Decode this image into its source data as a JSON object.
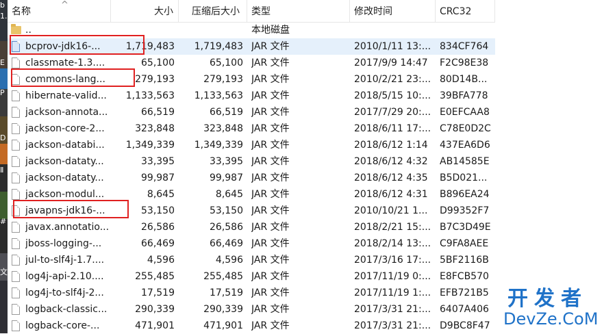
{
  "left_strip": {
    "glyphs": [
      "b",
      "1.",
      "E",
      "P",
      "D",
      "Ⅱ",
      "#",
      "文"
    ]
  },
  "header": {
    "columns": {
      "name": "名称",
      "size": "大小",
      "packed_size": "压缩后大小",
      "type": "类型",
      "modified": "修改时间",
      "crc": "CRC32"
    },
    "sort_indicator": "^"
  },
  "rows": [
    {
      "icon": "folder",
      "name": "..",
      "size": "",
      "packed": "",
      "type": "本地磁盘",
      "modified": "",
      "crc": ""
    },
    {
      "icon": "file",
      "name": "bcprov-jdk16-...",
      "size": "1,719,483",
      "packed": "1,719,483",
      "type": "JAR 文件",
      "modified": "2010/1/11 13:...",
      "crc": "834CF764"
    },
    {
      "icon": "file",
      "name": "classmate-1.3....",
      "size": "65,100",
      "packed": "65,100",
      "type": "JAR 文件",
      "modified": "2017/9/9 14:47",
      "crc": "F2C98E38"
    },
    {
      "icon": "file",
      "name": "commons-lang...",
      "size": "279,193",
      "packed": "279,193",
      "type": "JAR 文件",
      "modified": "2010/2/21 23:...",
      "crc": "80D14B..."
    },
    {
      "icon": "file",
      "name": "hibernate-valid...",
      "size": "1,133,563",
      "packed": "1,133,563",
      "type": "JAR 文件",
      "modified": "2018/5/15 10:...",
      "crc": "39BFA778"
    },
    {
      "icon": "file",
      "name": "jackson-annota...",
      "size": "66,519",
      "packed": "66,519",
      "type": "JAR 文件",
      "modified": "2017/7/29 20:...",
      "crc": "E0EFCAA8"
    },
    {
      "icon": "file",
      "name": "jackson-core-2...",
      "size": "323,848",
      "packed": "323,848",
      "type": "JAR 文件",
      "modified": "2018/6/11 17:...",
      "crc": "C78E0D2C"
    },
    {
      "icon": "file",
      "name": "jackson-databi...",
      "size": "1,349,339",
      "packed": "1,349,339",
      "type": "JAR 文件",
      "modified": "2018/6/12 1:14",
      "crc": "437EA6D6"
    },
    {
      "icon": "file",
      "name": "jackson-dataty...",
      "size": "33,395",
      "packed": "33,395",
      "type": "JAR 文件",
      "modified": "2018/6/12 4:32",
      "crc": "AB14585E"
    },
    {
      "icon": "file",
      "name": "jackson-dataty...",
      "size": "99,987",
      "packed": "99,987",
      "type": "JAR 文件",
      "modified": "2018/6/12 4:35",
      "crc": "B5D021..."
    },
    {
      "icon": "file",
      "name": "jackson-modul...",
      "size": "8,645",
      "packed": "8,645",
      "type": "JAR 文件",
      "modified": "2018/6/12 4:31",
      "crc": "B896EA24"
    },
    {
      "icon": "file",
      "name": "javapns-jdk16-...",
      "size": "53,150",
      "packed": "53,150",
      "type": "JAR 文件",
      "modified": "2010/10/21 1...",
      "crc": "D99352F7"
    },
    {
      "icon": "file",
      "name": "javax.annotatio...",
      "size": "26,586",
      "packed": "26,586",
      "type": "JAR 文件",
      "modified": "2018/2/21 15:...",
      "crc": "B7C3D49E"
    },
    {
      "icon": "file",
      "name": "jboss-logging-...",
      "size": "66,469",
      "packed": "66,469",
      "type": "JAR 文件",
      "modified": "2018/2/14 13:...",
      "crc": "C9FA8AEE"
    },
    {
      "icon": "file",
      "name": "jul-to-slf4j-1.7....",
      "size": "4,596",
      "packed": "4,596",
      "type": "JAR 文件",
      "modified": "2017/3/16 17:...",
      "crc": "5BF2116B"
    },
    {
      "icon": "file",
      "name": "log4j-api-2.10....",
      "size": "255,485",
      "packed": "255,485",
      "type": "JAR 文件",
      "modified": "2017/11/19 0:...",
      "crc": "E8FCB570"
    },
    {
      "icon": "file",
      "name": "log4j-to-slf4j-2...",
      "size": "17,519",
      "packed": "17,519",
      "type": "JAR 文件",
      "modified": "2017/11/19 1:...",
      "crc": "EFB721B5"
    },
    {
      "icon": "file",
      "name": "logback-classic...",
      "size": "290,339",
      "packed": "290,339",
      "type": "JAR 文件",
      "modified": "2017/3/31 21:...",
      "crc": "6407A406"
    },
    {
      "icon": "file",
      "name": "logback-core-...",
      "size": "471,901",
      "packed": "471,901",
      "type": "JAR 文件",
      "modified": "2017/3/31 21:...",
      "crc": "D9BC8F47"
    }
  ],
  "watermark": {
    "chinese": "开发者",
    "latin": "DevZe.CoM"
  },
  "colors": {
    "highlight_border": "#e02020",
    "selected_row": "#e5f0fb",
    "watermark": "#1f72c8"
  }
}
